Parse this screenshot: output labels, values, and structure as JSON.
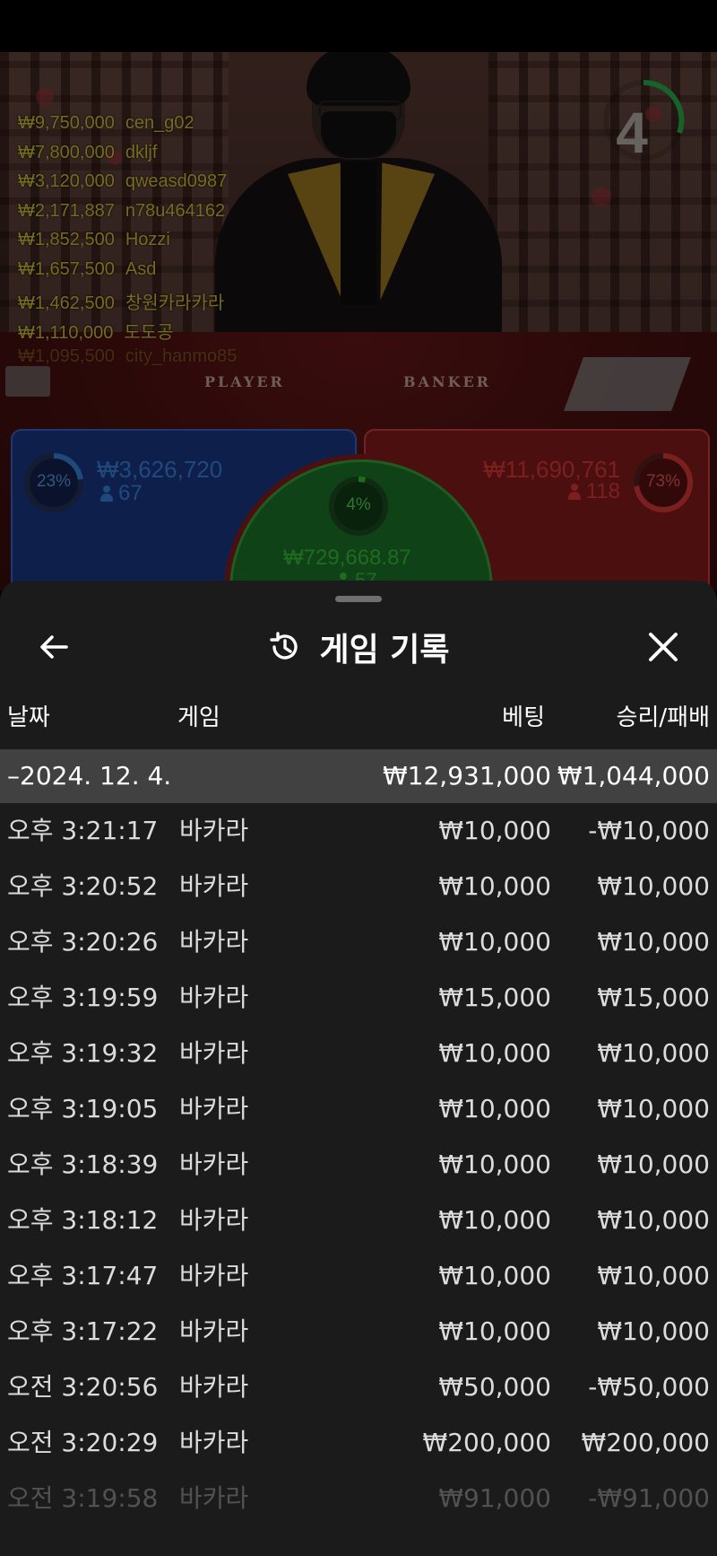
{
  "video": {
    "countdown": "4",
    "table_labels": {
      "player": "PLAYER",
      "banker": "BANKER"
    },
    "winners": [
      {
        "amount": "₩9,750,000",
        "user": "cen_g02"
      },
      {
        "amount": "₩7,800,000",
        "user": "dkljf"
      },
      {
        "amount": "₩3,120,000",
        "user": "qweasd0987"
      },
      {
        "amount": "₩2,171,887",
        "user": "n78u464162"
      },
      {
        "amount": "₩1,852,500",
        "user": "Hozzi"
      },
      {
        "amount": "₩1,657,500",
        "user": "Asd"
      },
      {
        "amount": "₩1,462,500",
        "user": "창원카라카라"
      },
      {
        "amount": "₩1,110,000",
        "user": "도도공"
      },
      {
        "amount": "₩1,095,500",
        "user": "city_hanmo85"
      }
    ]
  },
  "bets": {
    "player": {
      "percent": "23%",
      "amount": "₩3,626,720",
      "count": "67",
      "fraction": 0.23,
      "color": "#3a86e0"
    },
    "banker": {
      "percent": "73%",
      "amount": "₩11,690,761",
      "count": "118",
      "fraction": 0.73,
      "color": "#e03a3a"
    },
    "tie": {
      "percent": "4%",
      "amount": "₩729,668.87",
      "count": "57",
      "fraction": 0.04,
      "color": "#3ac43a"
    }
  },
  "sheet": {
    "title": "게임 기록",
    "columns": {
      "date": "날짜",
      "game": "게임",
      "bet": "베팅",
      "result": "승리/패배"
    },
    "day": {
      "date": "–2024. 12. 4.",
      "bet_total": "₩12,931,000",
      "result_total": "₩1,044,000"
    },
    "rows": [
      {
        "time": "오후 3:21:17",
        "game": "바카라",
        "bet": "₩10,000",
        "result": "-₩10,000"
      },
      {
        "time": "오후 3:20:52",
        "game": "바카라",
        "bet": "₩10,000",
        "result": "₩10,000"
      },
      {
        "time": "오후 3:20:26",
        "game": "바카라",
        "bet": "₩10,000",
        "result": "₩10,000"
      },
      {
        "time": "오후 3:19:59",
        "game": "바카라",
        "bet": "₩15,000",
        "result": "₩15,000"
      },
      {
        "time": "오후 3:19:32",
        "game": "바카라",
        "bet": "₩10,000",
        "result": "₩10,000"
      },
      {
        "time": "오후 3:19:05",
        "game": "바카라",
        "bet": "₩10,000",
        "result": "₩10,000"
      },
      {
        "time": "오후 3:18:39",
        "game": "바카라",
        "bet": "₩10,000",
        "result": "₩10,000"
      },
      {
        "time": "오후 3:18:12",
        "game": "바카라",
        "bet": "₩10,000",
        "result": "₩10,000"
      },
      {
        "time": "오후 3:17:47",
        "game": "바카라",
        "bet": "₩10,000",
        "result": "₩10,000"
      },
      {
        "time": "오후 3:17:22",
        "game": "바카라",
        "bet": "₩10,000",
        "result": "₩10,000"
      },
      {
        "time": "오전 3:20:56",
        "game": "바카라",
        "bet": "₩50,000",
        "result": "-₩50,000"
      },
      {
        "time": "오전 3:20:29",
        "game": "바카라",
        "bet": "₩200,000",
        "result": "₩200,000"
      },
      {
        "time": "오전 3:19:58",
        "game": "바카라",
        "bet": "₩91,000",
        "result": "-₩91,000"
      }
    ]
  }
}
